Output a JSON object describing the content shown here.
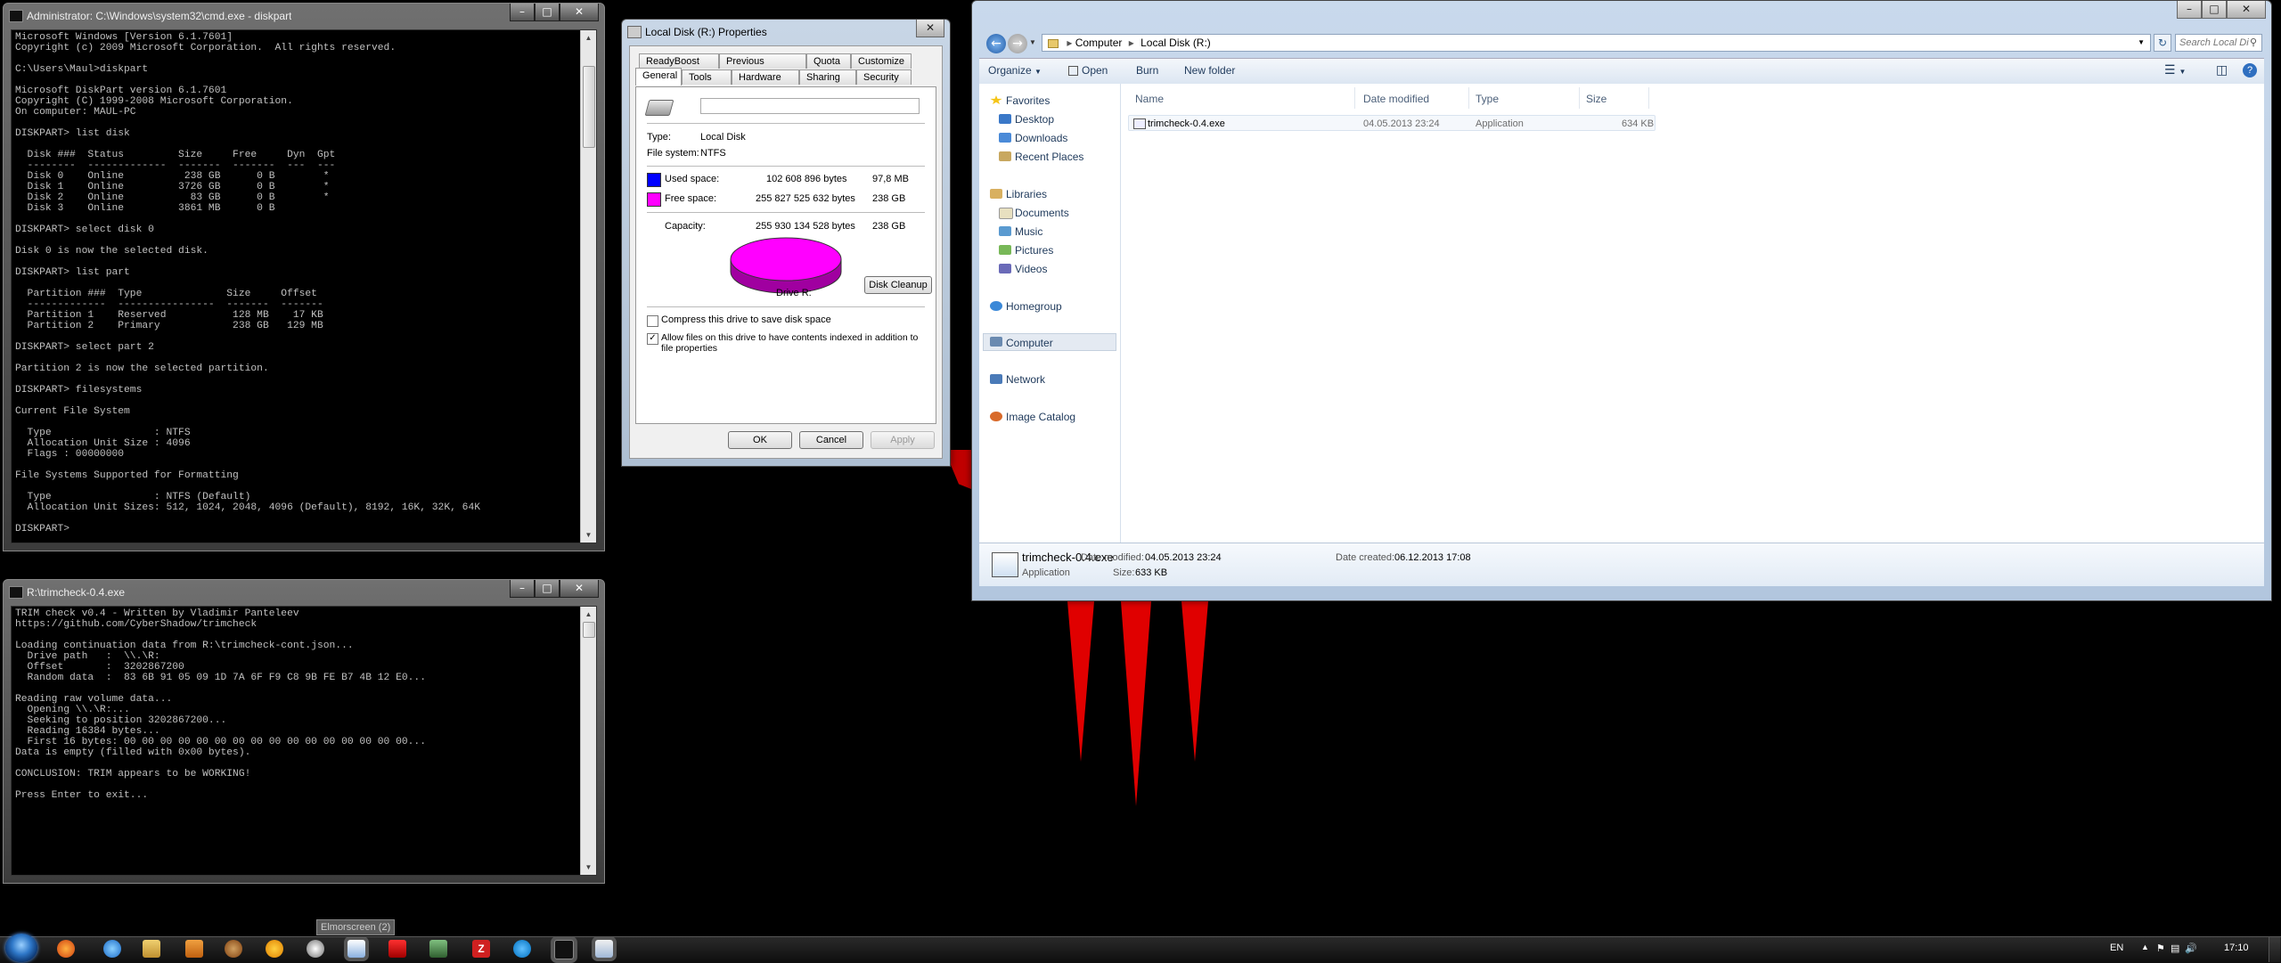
{
  "diskpart_window": {
    "title": "Administrator: C:\\Windows\\system32\\cmd.exe - diskpart",
    "console": "Microsoft Windows [Version 6.1.7601]\nCopyright (c) 2009 Microsoft Corporation.  All rights reserved.\n\nC:\\Users\\Maul>diskpart\n\nMicrosoft DiskPart version 6.1.7601\nCopyright (C) 1999-2008 Microsoft Corporation.\nOn computer: MAUL-PC\n\nDISKPART> list disk\n\n  Disk ###  Status         Size     Free     Dyn  Gpt\n  --------  -------------  -------  -------  ---  ---\n  Disk 0    Online          238 GB      0 B        *\n  Disk 1    Online         3726 GB      0 B        *\n  Disk 2    Online           83 GB      0 B        *\n  Disk 3    Online         3861 MB      0 B\n\nDISKPART> select disk 0\n\nDisk 0 is now the selected disk.\n\nDISKPART> list part\n\n  Partition ###  Type              Size     Offset\n  -------------  ----------------  -------  -------\n  Partition 1    Reserved           128 MB    17 KB\n  Partition 2    Primary            238 GB   129 MB\n\nDISKPART> select part 2\n\nPartition 2 is now the selected partition.\n\nDISKPART> filesystems\n\nCurrent File System\n\n  Type                 : NTFS\n  Allocation Unit Size : 4096\n  Flags : 00000000\n\nFile Systems Supported for Formatting\n\n  Type                 : NTFS (Default)\n  Allocation Unit Sizes: 512, 1024, 2048, 4096 (Default), 8192, 16K, 32K, 64K\n\nDISKPART> "
  },
  "trimcheck_window": {
    "title": "R:\\trimcheck-0.4.exe",
    "console": "TRIM check v0.4 - Written by Vladimir Panteleev\nhttps://github.com/CyberShadow/trimcheck\n\nLoading continuation data from R:\\trimcheck-cont.json...\n  Drive path   :  \\\\.\\R:\n  Offset       :  3202867200\n  Random data  :  83 6B 91 05 09 1D 7A 6F F9 C8 9B FE B7 4B 12 E0...\n\nReading raw volume data...\n  Opening \\\\.\\R:...\n  Seeking to position 3202867200...\n  Reading 16384 bytes...\n  First 16 bytes: 00 00 00 00 00 00 00 00 00 00 00 00 00 00 00 00...\nData is empty (filled with 0x00 bytes).\n\nCONCLUSION: TRIM appears to be WORKING!\n\nPress Enter to exit..."
  },
  "properties_dialog": {
    "title": "Local Disk (R:) Properties",
    "tabs_top": [
      "ReadyBoost",
      "Previous Versions",
      "Quota",
      "Customize"
    ],
    "tabs_bottom": [
      "General",
      "Tools",
      "Hardware",
      "Sharing",
      "Security"
    ],
    "name_value": "",
    "type_label": "Type:",
    "type_value": "Local Disk",
    "fs_label": "File system:",
    "fs_value": "NTFS",
    "used_label": "Used space:",
    "used_bytes": "102 608 896 bytes",
    "used_short": "97,8 MB",
    "free_label": "Free space:",
    "free_bytes": "255 827 525 632 bytes",
    "free_short": "238 GB",
    "cap_label": "Capacity:",
    "cap_bytes": "255 930 134 528 bytes",
    "cap_short": "238 GB",
    "drive_label": "Drive R:",
    "cleanup_button": "Disk Cleanup",
    "compress_label": "Compress this drive to save disk space",
    "index_label": "Allow files on this drive to have contents indexed in addition to file properties",
    "ok": "OK",
    "cancel": "Cancel",
    "apply": "Apply",
    "used_color": "#0000ff",
    "free_color": "#ff00ff",
    "used_fraction": 0.0004
  },
  "explorer": {
    "breadcrumb": [
      "Computer",
      "Local Disk (R:)"
    ],
    "search_placeholder": "Search Local Disk (R:)",
    "toolbar": {
      "organize": "Organize",
      "open": "Open",
      "burn": "Burn",
      "new_folder": "New folder"
    },
    "nav": {
      "favorites": "Favorites",
      "desktop": "Desktop",
      "downloads": "Downloads",
      "recent": "Recent Places",
      "libraries": "Libraries",
      "documents": "Documents",
      "music": "Music",
      "pictures": "Pictures",
      "videos": "Videos",
      "homegroup": "Homegroup",
      "computer": "Computer",
      "network": "Network",
      "image_catalog": "Image Catalog"
    },
    "columns": [
      "Name",
      "Date modified",
      "Type",
      "Size"
    ],
    "file": {
      "name": "trimcheck-0.4.exe",
      "date": "04.05.2013 23:24",
      "type": "Application",
      "size": "634 KB"
    },
    "details": {
      "name": "trimcheck-0.4.exe",
      "kind": "Application",
      "modified_label": "Date modified:",
      "modified": "04.05.2013 23:24",
      "created_label": "Date created:",
      "created": "06.12.2013 17:08",
      "size_label": "Size:",
      "size": "633 KB"
    }
  },
  "taskbar": {
    "tooltip": "Elmorscreen (2)",
    "language": "EN",
    "clock": "17:10"
  }
}
